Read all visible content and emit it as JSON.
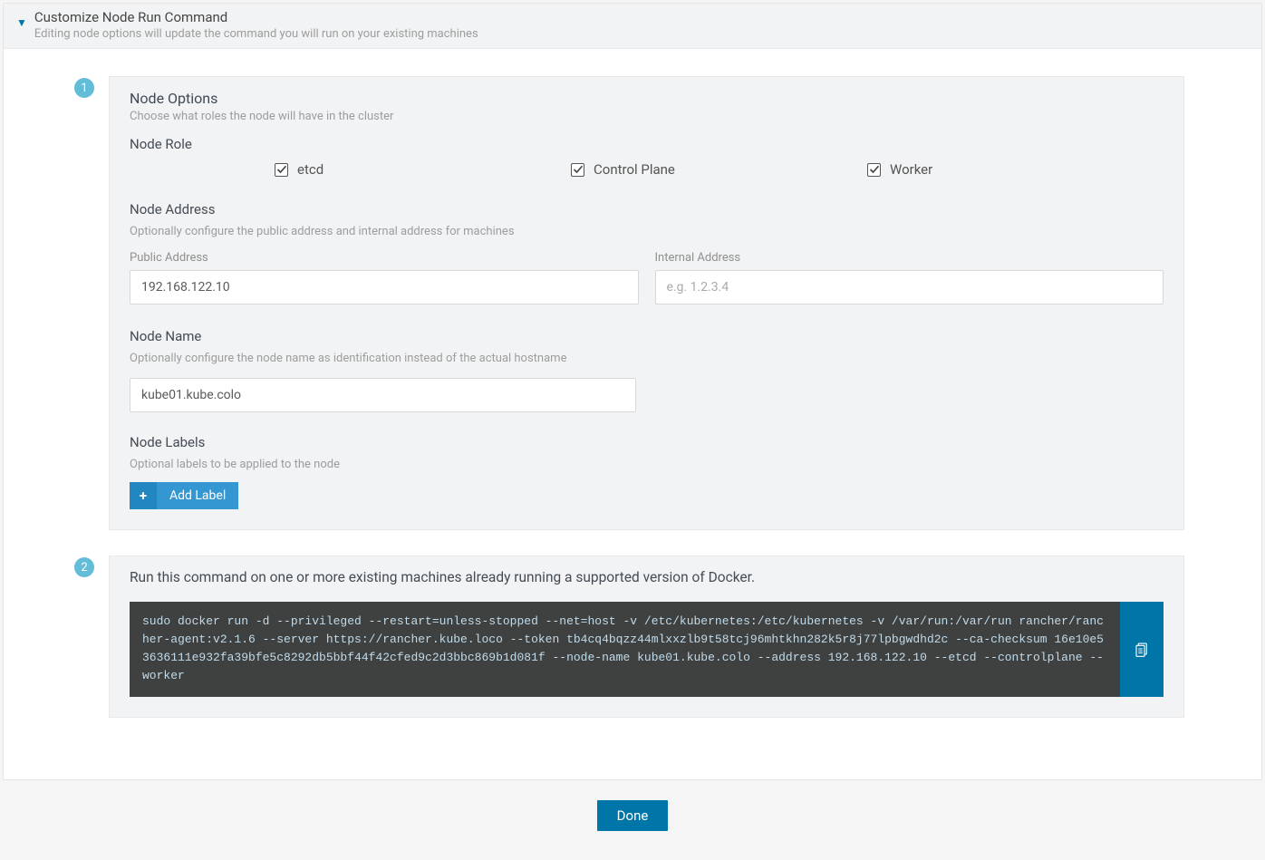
{
  "header": {
    "title": "Customize Node Run Command",
    "sub": "Editing node options will update the command you will run on your existing machines"
  },
  "step1": {
    "badge": "1",
    "title": "Node Options",
    "sub": "Choose what roles the node will have in the cluster",
    "node_role": {
      "heading": "Node Role",
      "options": {
        "etcd": "etcd",
        "control_plane": "Control Plane",
        "worker": "Worker"
      }
    },
    "node_address": {
      "heading": "Node Address",
      "sub": "Optionally configure the public address and internal address for machines",
      "public_label": "Public Address",
      "public_value": "192.168.122.10",
      "internal_label": "Internal Address",
      "internal_placeholder": "e.g. 1.2.3.4",
      "internal_value": ""
    },
    "node_name": {
      "heading": "Node Name",
      "sub": "Optionally configure the node name as identification instead of the actual hostname",
      "value": "kube01.kube.colo"
    },
    "node_labels": {
      "heading": "Node Labels",
      "sub": "Optional labels to be applied to the node",
      "add_button": "Add Label"
    }
  },
  "step2": {
    "badge": "2",
    "title": "Run this command on one or more existing machines already running a supported version of Docker.",
    "command": "sudo docker run -d --privileged --restart=unless-stopped --net=host -v /etc/kubernetes:/etc/kubernetes -v /var/run:/var/run rancher/rancher-agent:v2.1.6 --server https://rancher.kube.loco --token tb4cq4bqzz44mlxxzlb9t58tcj96mhtkhn282k5r8j77lpbgwdhd2c --ca-checksum 16e10e53636111e932fa39bfe5c8292db5bbf44f42cfed9c2d3bbc869b1d081f --node-name kube01.kube.colo --address 192.168.122.10 --etcd --controlplane --worker"
  },
  "footer": {
    "done": "Done"
  }
}
